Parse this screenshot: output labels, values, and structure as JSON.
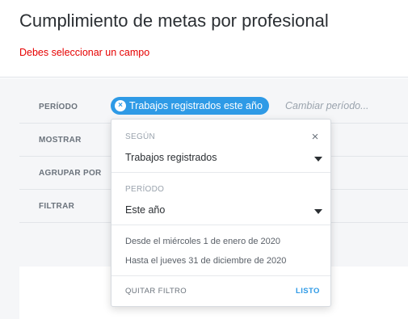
{
  "header": {
    "title": "Cumplimiento de metas por profesional",
    "error": "Debes seleccionar un campo"
  },
  "filters": {
    "period_label": "PERÍODO",
    "show_label": "MOSTRAR",
    "group_label": "AGRUPAR POR",
    "filter_label": "FILTRAR",
    "chip": {
      "remove_symbol": "×",
      "text": "Trabajos registrados este año"
    },
    "change_period": "Cambiar período..."
  },
  "popover": {
    "segun_caption": "SEGÚN",
    "segun_value": "Trabajos registrados",
    "periodo_caption": "PERÍODO",
    "periodo_value": "Este año",
    "close_symbol": "×",
    "from_text": "Desde el miércoles 1 de enero de 2020",
    "to_text": "Hasta el jueves 31 de diciembre de 2020",
    "remove_filter": "QUITAR FILTRO",
    "done": "LISTO"
  },
  "colors": {
    "accent": "#2e9ae6",
    "error": "#e60000"
  },
  "icons": {
    "chip_remove": "close-circle-icon",
    "popover_close": "close-icon",
    "select_caret": "caret-down-icon"
  }
}
